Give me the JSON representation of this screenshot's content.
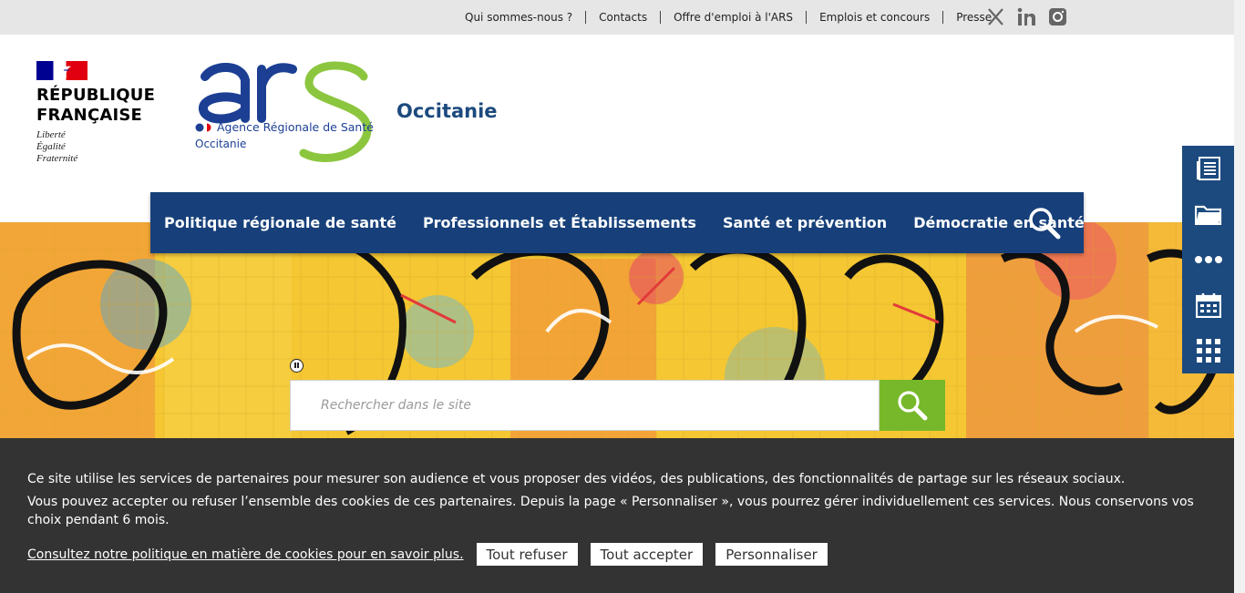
{
  "top_links": [
    "Qui sommes-nous ?",
    "Contacts",
    "Offre d'emploi à l'ARS",
    "Emplois et concours",
    "Presse"
  ],
  "social_icons": [
    "x-icon",
    "linkedin-icon",
    "instagram-icon"
  ],
  "rf_logo": {
    "name_line1": "RÉPUBLIQUE",
    "name_line2": "FRANÇAISE",
    "motto": [
      "Liberté",
      "Égalité",
      "Fraternité"
    ]
  },
  "ars_logo": {
    "letters": "arS",
    "subtitle": "Agence Régionale de Santé",
    "region": "Occitanie"
  },
  "region_title": "Occitanie",
  "nav": [
    "Politique régionale de santé",
    "Professionnels et Établissements",
    "Santé et prévention",
    "Démocratie en santé"
  ],
  "side_tools": [
    "document-list-icon",
    "folder-icon",
    "more-dots-icon",
    "calendar-icon",
    "grid-apps-icon"
  ],
  "search": {
    "placeholder": "Rechercher dans le site"
  },
  "cookie": {
    "line1": "Ce site utilise les services de partenaires pour mesurer son audience et vous proposer des vidéos, des publications, des fonctionnalités de partage sur les réseaux sociaux.",
    "line2": "Vous pouvez accepter ou refuser l’ensemble des cookies de ces partenaires. Depuis la page « Personnaliser », vous pourrez gérer individuellement ces services. Nous conservons vos choix pendant 6 mois.",
    "policy_link": "Consultez notre politique en matière de cookies pour en savoir plus.",
    "refuse": "Tout refuser",
    "accept": "Tout accepter",
    "customize": "Personnaliser"
  },
  "colors": {
    "nav_bg": "#17407a",
    "accent_green": "#76b82a",
    "cookie_bg": "#333333",
    "topbar_bg": "#e6e6e6"
  }
}
